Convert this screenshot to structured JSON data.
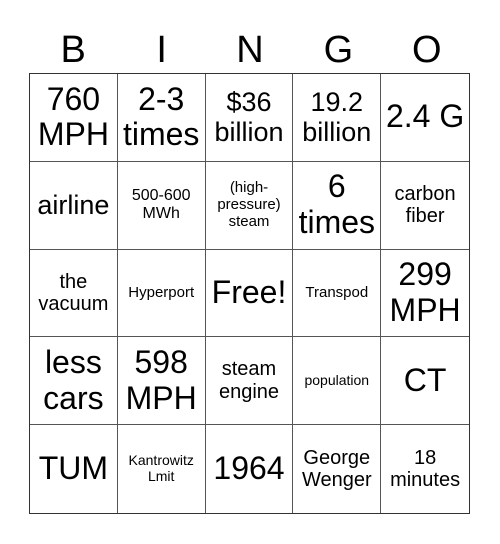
{
  "header": [
    "B",
    "I",
    "N",
    "G",
    "O"
  ],
  "cells": [
    {
      "text": "760 MPH",
      "size": "s1"
    },
    {
      "text": "2-3 times",
      "size": "s1"
    },
    {
      "text": "$36 billion",
      "size": "s2"
    },
    {
      "text": "19.2 billion",
      "size": "s2"
    },
    {
      "text": "2.4 G",
      "size": "s1"
    },
    {
      "text": "airline",
      "size": "s2"
    },
    {
      "text": "500-600 MWh",
      "size": "s4"
    },
    {
      "text": "(high-pressure) steam",
      "size": "s5"
    },
    {
      "text": "6 times",
      "size": "s1"
    },
    {
      "text": "carbon fiber",
      "size": "s3"
    },
    {
      "text": "the vacuum",
      "size": "s3"
    },
    {
      "text": "Hyperport",
      "size": "s5"
    },
    {
      "text": "Free!",
      "size": "s1"
    },
    {
      "text": "Transpod",
      "size": "s5"
    },
    {
      "text": "299 MPH",
      "size": "s1"
    },
    {
      "text": "less cars",
      "size": "s1"
    },
    {
      "text": "598 MPH",
      "size": "s1"
    },
    {
      "text": "steam engine",
      "size": "s3"
    },
    {
      "text": "population",
      "size": "s6"
    },
    {
      "text": "CT",
      "size": "s1"
    },
    {
      "text": "TUM",
      "size": "s1"
    },
    {
      "text": "Kantrowitz Lmit",
      "size": "s6"
    },
    {
      "text": "1964",
      "size": "s1"
    },
    {
      "text": "George Wenger",
      "size": "s3"
    },
    {
      "text": "18 minutes",
      "size": "s3"
    }
  ]
}
